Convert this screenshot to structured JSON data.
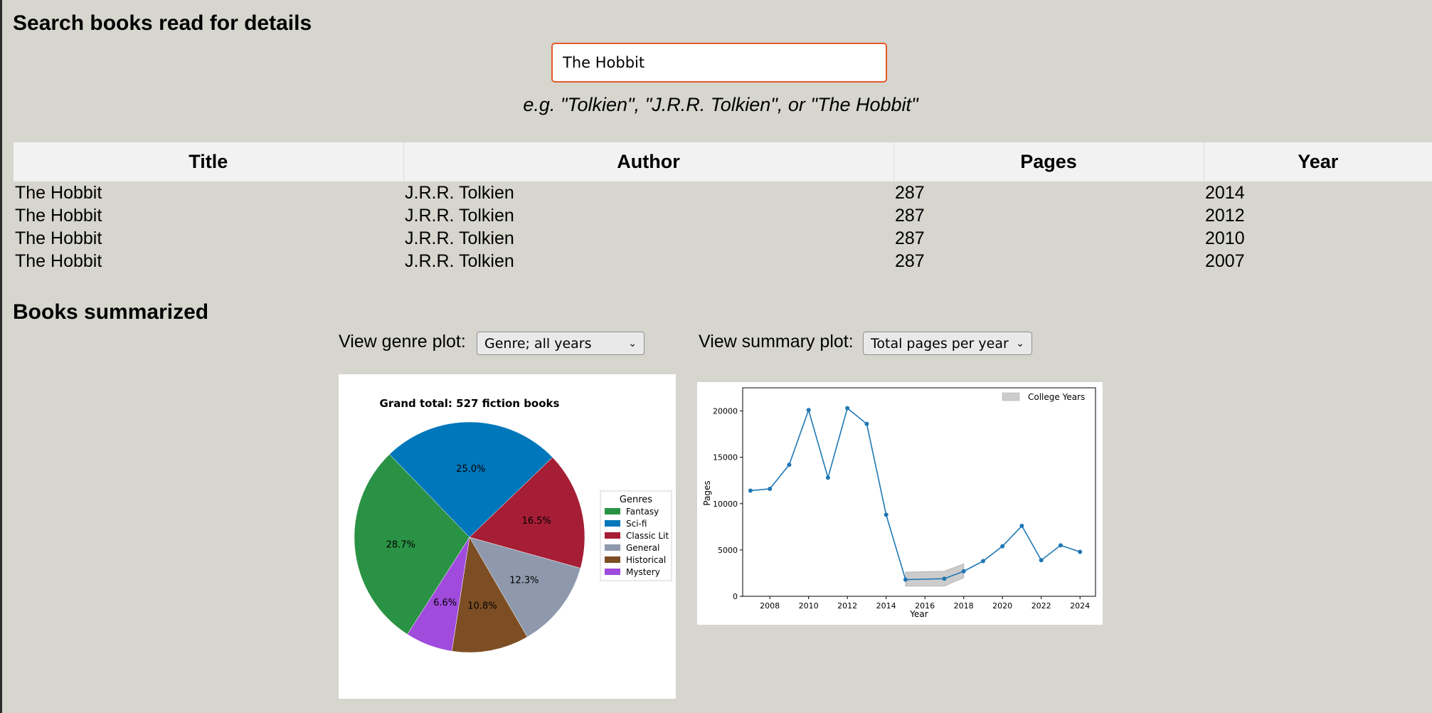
{
  "search": {
    "heading": "Search books read for details",
    "value": "The Hobbit",
    "hint": "e.g. \"Tolkien\", \"J.R.R. Tolkien\", or \"The Hobbit\""
  },
  "results": {
    "columns": [
      "Title",
      "Author",
      "Pages",
      "Year"
    ],
    "rows": [
      [
        "The Hobbit",
        "J.R.R. Tolkien",
        "287",
        "2014"
      ],
      [
        "The Hobbit",
        "J.R.R. Tolkien",
        "287",
        "2012"
      ],
      [
        "The Hobbit",
        "J.R.R. Tolkien",
        "287",
        "2010"
      ],
      [
        "The Hobbit",
        "J.R.R. Tolkien",
        "287",
        "2007"
      ]
    ]
  },
  "summary": {
    "heading": "Books summarized",
    "genre_label": "View genre plot:",
    "genre_selected": "Genre; all years",
    "summary_label": "View summary plot:",
    "summary_selected": "Total pages per year"
  },
  "chart_data": [
    {
      "type": "pie",
      "title": "Grand total: 527 fiction books",
      "legend_title": "Genres",
      "legend_position": "right",
      "labels": [
        "Fantasy",
        "Sci-fi",
        "Classic Lit",
        "General",
        "Historical",
        "Mystery"
      ],
      "values": [
        28.7,
        25.0,
        16.5,
        12.3,
        10.8,
        6.6
      ],
      "value_labels": [
        "28.7%",
        "25.0%",
        "16.5%",
        "12.3%",
        "10.8%",
        "6.6%"
      ],
      "colors": [
        "#2a9244",
        "#0077bb",
        "#a51e35",
        "#8e99ad",
        "#7d4e24",
        "#a04bdc"
      ]
    },
    {
      "type": "line",
      "xlabel": "Year",
      "ylabel": "Pages",
      "x": [
        2007,
        2008,
        2009,
        2010,
        2011,
        2012,
        2013,
        2014,
        2015,
        2017,
        2018,
        2019,
        2020,
        2021,
        2022,
        2023,
        2024
      ],
      "y": [
        11400,
        11600,
        14200,
        20100,
        12800,
        20300,
        18600,
        8800,
        1800,
        1900,
        2700,
        3800,
        5400,
        7600,
        3900,
        5500,
        4800
      ],
      "xlim": [
        2006.6,
        2024.8
      ],
      "ylim": [
        0,
        22500
      ],
      "xticks": [
        2008,
        2010,
        2012,
        2014,
        2016,
        2018,
        2020,
        2022,
        2024
      ],
      "yticks": [
        0,
        5000,
        10000,
        15000,
        20000
      ],
      "band": {
        "name": "College Years",
        "x": [
          2015,
          2017,
          2018
        ],
        "lower": [
          1100,
          1100,
          2000
        ],
        "upper": [
          2600,
          2700,
          3500
        ],
        "color": "#cccccc"
      },
      "line_color": "#1f77b4",
      "grid": false,
      "legend_position": "top-right"
    }
  ]
}
